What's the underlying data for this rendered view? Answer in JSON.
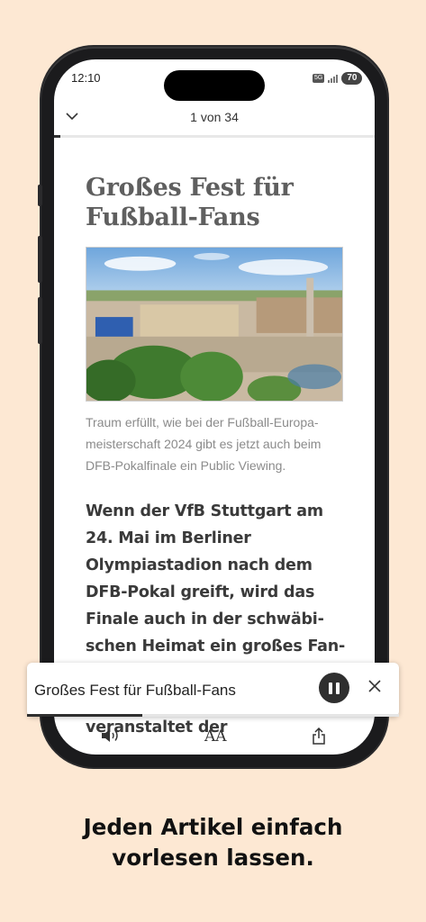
{
  "status": {
    "time": "12:10",
    "network": "5G",
    "battery": "70"
  },
  "nav": {
    "page_count": "1 von 34",
    "progress": 0.03
  },
  "article": {
    "headline": "Großes Fest für Fußball-Fans",
    "caption": "Traum erfüllt, wie bei der Fußball-Europa-meisterschaft 2024 gibt es jetzt auch beim DFB-Pokalfinale ein Public Viewing.",
    "lead": "Wenn der VfB Stuttgart am 24. Mai im Berliner Olympiastadion nach dem DFB-Pokal greift, wird das Finale auch in der schwäbi-schen Heimat ein großes Fan-spektakel. In Kooperation mit der Landeshauptstadt veranstaltet der"
  },
  "player": {
    "title": "Großes Fest für Fußball-Fans",
    "progress": 0.31
  },
  "toolbar": {
    "speaker_icon": "speaker-icon",
    "text_size_label": "AA",
    "share_icon": "share-icon"
  },
  "tagline": {
    "line1": "Jeden Artikel einfach",
    "line2": "vorlesen lassen."
  },
  "colors": {
    "background": "#fde8d3",
    "headline": "#5f5f5f",
    "accent_dark": "#2f2f2f"
  }
}
